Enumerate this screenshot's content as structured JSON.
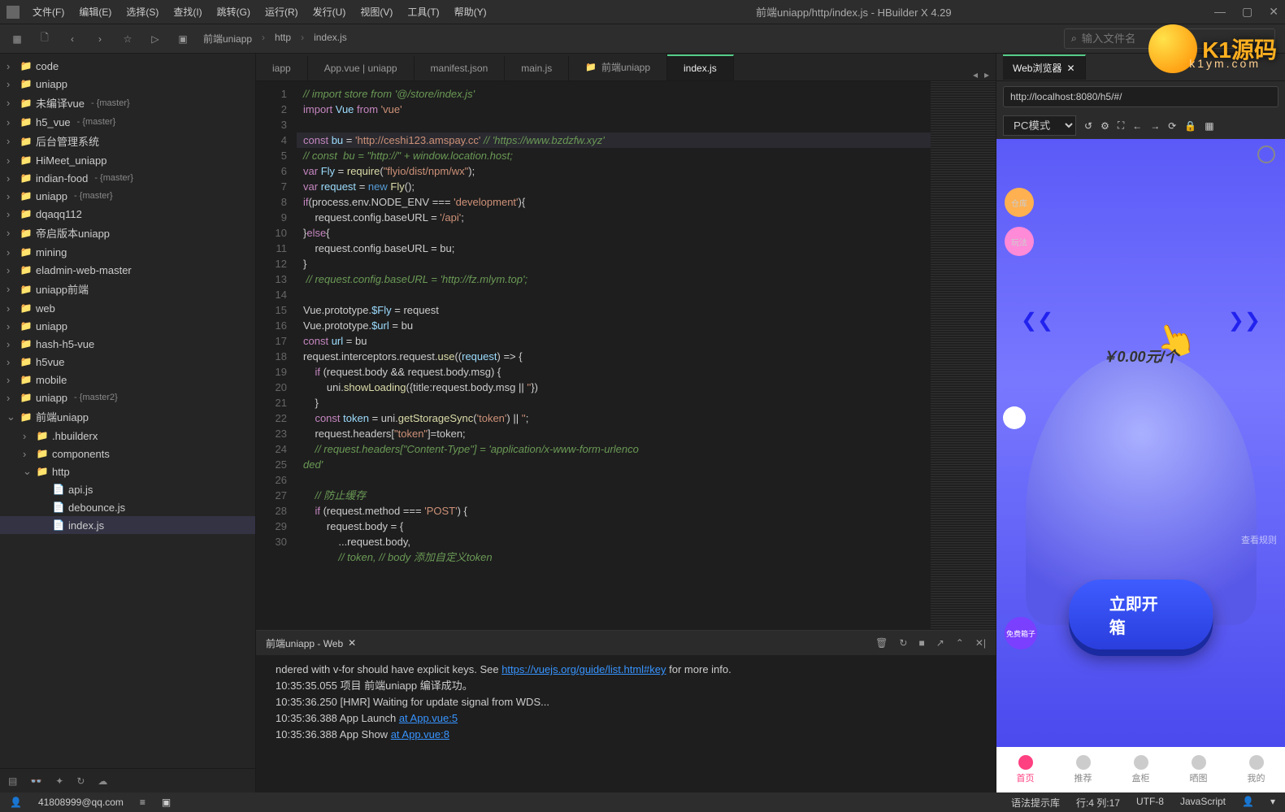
{
  "window": {
    "title": "前端uniapp/http/index.js - HBuilder X 4.29"
  },
  "menu": [
    "文件(F)",
    "编辑(E)",
    "选择(S)",
    "查找(I)",
    "跳转(G)",
    "运行(R)",
    "发行(U)",
    "视图(V)",
    "工具(T)",
    "帮助(Y)"
  ],
  "breadcrumb": [
    "前端uniapp",
    "http",
    "index.js"
  ],
  "search": {
    "placeholder": "输入文件名"
  },
  "tree": [
    {
      "icon": "folder",
      "label": "code",
      "depth": 0,
      "chev": "›"
    },
    {
      "icon": "folder",
      "label": "uniapp",
      "depth": 0,
      "chev": "›"
    },
    {
      "icon": "folder",
      "label": "未编译vue",
      "branch": "- {master}",
      "depth": 0,
      "chev": "›"
    },
    {
      "icon": "folder",
      "label": "h5_vue",
      "branch": "- {master}",
      "depth": 0,
      "chev": "›"
    },
    {
      "icon": "folder",
      "label": "后台管理系统",
      "depth": 0,
      "chev": "›"
    },
    {
      "icon": "folder",
      "label": "HiMeet_uniapp",
      "depth": 0,
      "chev": "›"
    },
    {
      "icon": "folder",
      "label": "indian-food",
      "branch": "- {master}",
      "depth": 0,
      "chev": "›"
    },
    {
      "icon": "folder",
      "label": "uniapp",
      "branch": "- {master}",
      "depth": 0,
      "chev": "›"
    },
    {
      "icon": "folder",
      "label": "dqaqq112",
      "depth": 0,
      "chev": "›"
    },
    {
      "icon": "folder",
      "label": "帝启版本uniapp",
      "depth": 0,
      "chev": "›"
    },
    {
      "icon": "folder",
      "label": "mining",
      "depth": 0,
      "chev": "›"
    },
    {
      "icon": "folder",
      "label": "eladmin-web-master",
      "depth": 0,
      "chev": "›"
    },
    {
      "icon": "folder",
      "label": "uniapp前端",
      "depth": 0,
      "chev": "›"
    },
    {
      "icon": "folder",
      "label": "web",
      "depth": 0,
      "chev": "›"
    },
    {
      "icon": "folder",
      "label": "uniapp",
      "depth": 0,
      "chev": "›"
    },
    {
      "icon": "folder",
      "label": "hash-h5-vue",
      "depth": 0,
      "chev": "›"
    },
    {
      "icon": "folder",
      "label": "h5vue",
      "depth": 0,
      "chev": "›"
    },
    {
      "icon": "folder",
      "label": "mobile",
      "depth": 0,
      "chev": "›"
    },
    {
      "icon": "folder",
      "label": "uniapp",
      "branch": "- {master2}",
      "depth": 0,
      "chev": "›"
    },
    {
      "icon": "folder",
      "label": "前端uniapp",
      "depth": 0,
      "chev": "⌄"
    },
    {
      "icon": "folder",
      "label": ".hbuilderx",
      "depth": 1,
      "chev": "›"
    },
    {
      "icon": "folder",
      "label": "components",
      "depth": 1,
      "chev": "›"
    },
    {
      "icon": "folder",
      "label": "http",
      "depth": 1,
      "chev": "⌄"
    },
    {
      "icon": "file",
      "label": "api.js",
      "depth": 2,
      "chev": ""
    },
    {
      "icon": "file",
      "label": "debounce.js",
      "depth": 2,
      "chev": ""
    },
    {
      "icon": "file",
      "label": "index.js",
      "depth": 2,
      "chev": "",
      "active": true
    }
  ],
  "tabs": [
    {
      "label": "iapp"
    },
    {
      "label": "App.vue | uniapp"
    },
    {
      "label": "manifest.json"
    },
    {
      "label": "main.js"
    },
    {
      "label": "前端uniapp",
      "icon": "📁"
    },
    {
      "label": "index.js",
      "active": true
    }
  ],
  "preview_tab": {
    "label": "Web浏览器"
  },
  "url": "http://localhost:8080/h5/#/",
  "pc_mode": "PC模式",
  "price": "￥0.00元/个",
  "open_btn": "立即开箱",
  "free_box": "免费箱子",
  "side": {
    "a": "仓库",
    "b": "玩法"
  },
  "plan": "查看规则",
  "phone_nav": [
    {
      "label": "首页",
      "active": true
    },
    {
      "label": "推荐"
    },
    {
      "label": "盒柜"
    },
    {
      "label": "晒图"
    },
    {
      "label": "我的"
    }
  ],
  "console_tab": "前端uniapp - Web",
  "console_lines": [
    {
      "pre": "ndered with v-for should have explicit keys. See ",
      "link": "https://vuejs.org/guide/list.html#key",
      "post": " for more info."
    },
    {
      "pre": "10:35:35.055 项目 前端uniapp 编译成功。"
    },
    {
      "pre": "10:35:36.250 [HMR] Waiting for update signal from WDS..."
    },
    {
      "pre": "10:35:36.388 App Launch ",
      "link": "at App.vue:5"
    },
    {
      "pre": "10:35:36.388 App Show ",
      "link": "at App.vue:8"
    }
  ],
  "status": {
    "user": "41808999@qq.com",
    "hint": "语法提示库",
    "pos": "行:4  列:17",
    "enc": "UTF-8",
    "lang": "JavaScript"
  },
  "logo": {
    "text": "K1源码",
    "sub": "k1ym.com"
  },
  "code": [
    {
      "n": 1,
      "html": "<span class='cm'>// import store from '@/store/index.js'</span>"
    },
    {
      "n": 2,
      "html": "<span class='kw'>import</span> <span class='var'>Vue</span> <span class='kw'>from</span> <span class='str'>'vue'</span>"
    },
    {
      "n": 3,
      "html": ""
    },
    {
      "n": 4,
      "html": "<span class='kw'>const</span> <span class='var'>bu</span> <span class='op'>=</span> <span class='str'>'http://ceshi123.amspay.cc'</span> <span class='cm'>// 'https://www.bzdzfw.xyz'</span>",
      "current": true
    },
    {
      "n": 5,
      "html": "<span class='cm'>// const  bu = \"http://\" + window.location.host;</span>"
    },
    {
      "n": 6,
      "html": "<span class='kw'>var</span> <span class='var'>Fly</span> <span class='op'>=</span> <span class='fn'>require</span>(<span class='str'>\"flyio/dist/npm/wx\"</span>);"
    },
    {
      "n": 7,
      "html": "<span class='kw'>var</span> <span class='var'>request</span> <span class='op'>=</span> <span class='new'>new</span> <span class='fn'>Fly</span>();"
    },
    {
      "n": 8,
      "html": "<span class='kw'>if</span>(process.env.NODE_ENV <span class='op'>===</span> <span class='str'>'development'</span>){"
    },
    {
      "n": 9,
      "html": "    request.config.baseURL <span class='op'>=</span> <span class='str'>'/api'</span>;"
    },
    {
      "n": 10,
      "html": "}<span class='kw'>else</span>{"
    },
    {
      "n": 11,
      "html": "    request.config.baseURL <span class='op'>=</span> bu;"
    },
    {
      "n": 12,
      "html": "}"
    },
    {
      "n": 13,
      "html": " <span class='cm'>// request.config.baseURL = 'http://fz.mlym.top';</span>"
    },
    {
      "n": 14,
      "html": ""
    },
    {
      "n": 15,
      "html": "Vue.prototype.<span class='var'>$Fly</span> <span class='op'>=</span> request"
    },
    {
      "n": 16,
      "html": "Vue.prototype.<span class='var'>$url</span> <span class='op'>=</span> bu"
    },
    {
      "n": 17,
      "html": "<span class='kw'>const</span> <span class='var'>url</span> <span class='op'>=</span> bu"
    },
    {
      "n": 18,
      "html": "request.interceptors.request.<span class='fn'>use</span>((<span class='var'>request</span>) <span class='op'>=&gt;</span> {"
    },
    {
      "n": 19,
      "html": "    <span class='kw'>if</span> (request.body <span class='op'>&amp;&amp;</span> request.body.msg) {"
    },
    {
      "n": 20,
      "html": "        uni.<span class='fn'>showLoading</span>({title:request.body.msg <span class='op'>||</span> <span class='str'>''</span>})"
    },
    {
      "n": 21,
      "html": "    }"
    },
    {
      "n": 22,
      "html": "    <span class='kw'>const</span> <span class='var'>token</span> <span class='op'>=</span> uni.<span class='fn'>getStorageSync</span>(<span class='str'>'token'</span>) <span class='op'>||</span> <span class='str'>''</span>;"
    },
    {
      "n": 23,
      "html": "    request.headers[<span class='str'>\"token\"</span>]=token;"
    },
    {
      "n": 24,
      "html": "    <span class='cm'>// request.headers[\"Content-Type\"] = 'application/x-www-form-urlenco</span>"
    },
    {
      "n": "",
      "html": "<span class='cm'>ded'</span>"
    },
    {
      "n": 25,
      "html": ""
    },
    {
      "n": 26,
      "html": "    <span class='cm'>// 防止缓存</span>"
    },
    {
      "n": 27,
      "html": "    <span class='kw'>if</span> (request.method <span class='op'>===</span> <span class='str'>'POST'</span>) {"
    },
    {
      "n": 28,
      "html": "        request.body <span class='op'>=</span> {"
    },
    {
      "n": 29,
      "html": "            ...request.body,"
    },
    {
      "n": 30,
      "html": "            <span class='cm'>// token, // body 添加自定义token</span>"
    }
  ]
}
